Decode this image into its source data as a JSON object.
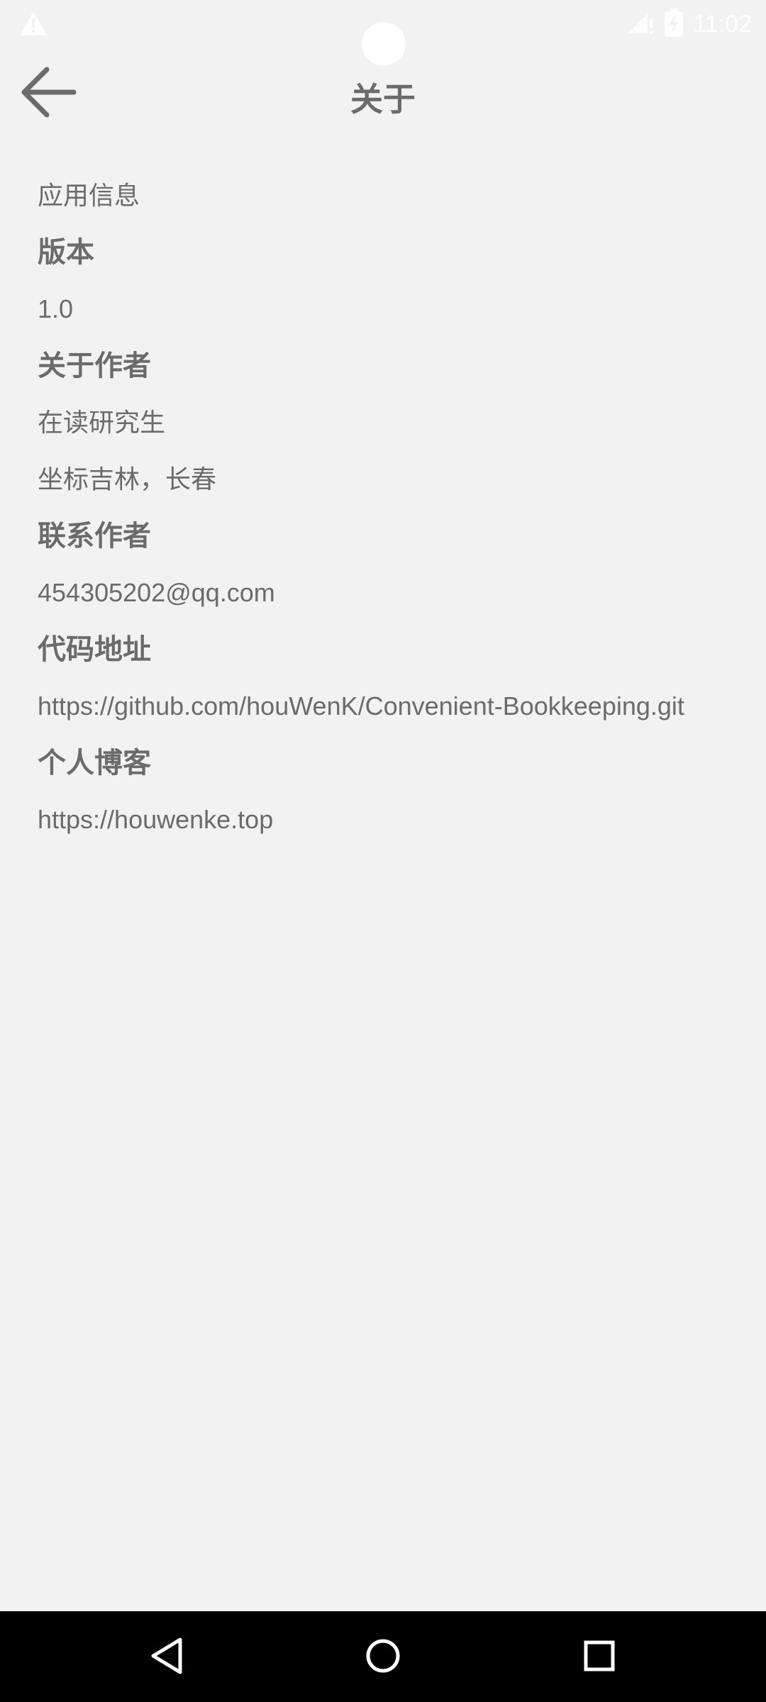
{
  "status_bar": {
    "time": "11:02",
    "icons": [
      "alert-icon",
      "signal-icon",
      "battery-icon"
    ]
  },
  "app_bar": {
    "title": "关于",
    "back_icon": "arrow-left-icon"
  },
  "content": {
    "app_info_label": "应用信息",
    "version_heading": "版本",
    "version_value": "1.0",
    "author_heading": "关于作者",
    "author_line1": "在读研究生",
    "author_line2": "坐标吉林，长春",
    "contact_heading": "联系作者",
    "contact_email": "454305202@qq.com",
    "code_heading": "代码地址",
    "code_url": "https://github.com/houWenK/Convenient-Bookkeeping.git",
    "blog_heading": "个人博客",
    "blog_url": "https://houwenke.top"
  },
  "nav_bar": {
    "icons": [
      "back-triangle-icon",
      "home-circle-icon",
      "recents-square-icon"
    ]
  },
  "colors": {
    "background": "#f2f2f2",
    "text": "#6b6b6b",
    "nav_bar": "#000000",
    "status_icons": "#ffffff"
  }
}
